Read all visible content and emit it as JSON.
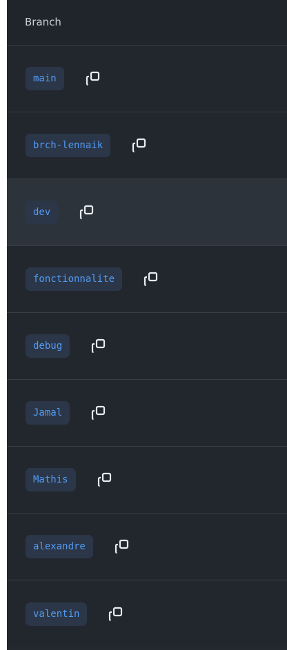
{
  "header": {
    "title": "Branch"
  },
  "branches": [
    {
      "name": "main"
    },
    {
      "name": "brch-lennaik"
    },
    {
      "name": "dev"
    },
    {
      "name": "fonctionnalite"
    },
    {
      "name": "debug"
    },
    {
      "name": "Jamal"
    },
    {
      "name": "Mathis"
    },
    {
      "name": "alexandre"
    },
    {
      "name": "valentin"
    }
  ],
  "icons": {
    "copy": "copy-icon"
  },
  "colors": {
    "background": "#22272e",
    "highlight_row": "#2d333b",
    "chip_background": "#2b3748",
    "chip_text": "#539bf5",
    "divider": "#373e47",
    "header_text": "#c9d1d9"
  }
}
